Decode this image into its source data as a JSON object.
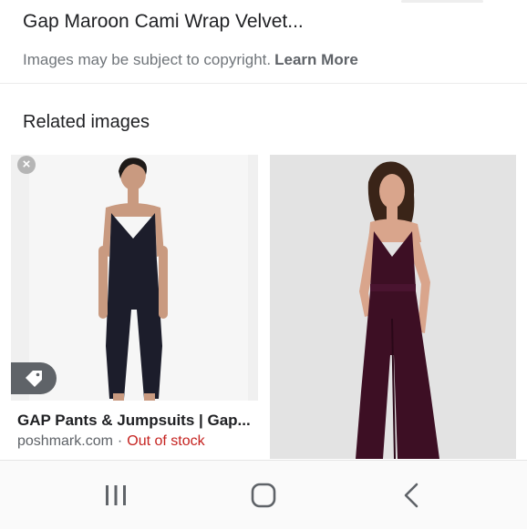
{
  "header": {
    "title": "Gap Maroon Cami Wrap Velvet...",
    "copyright_text": "Images may be subject to copyright.",
    "learn_more": "Learn More"
  },
  "related": {
    "heading": "Related images",
    "items": [
      {
        "caption": "GAP Pants & Jumpsuits | Gap...",
        "source": "poshmark.com",
        "separator": "·",
        "status": "Out of stock",
        "status_color": "#c5221f"
      },
      {
        "caption": "",
        "source": ""
      }
    ]
  },
  "icons": {
    "remove": "close-icon",
    "tag": "tag-icon",
    "recents": "recent-apps-icon",
    "home": "home-icon",
    "back": "back-icon"
  },
  "colors": {
    "jumpsuit_navy": "#1c1d2b",
    "jumpsuit_maroon": "#3d0f24",
    "accent_red": "#c5221f"
  }
}
